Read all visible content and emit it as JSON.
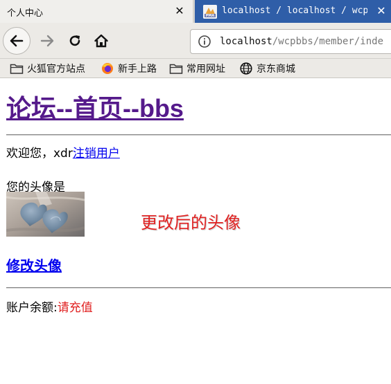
{
  "browser": {
    "tabs": [
      {
        "title": "个人中心",
        "active": true
      },
      {
        "title": "localhost / localhost / wcpbbs",
        "active": false
      }
    ],
    "tab_close_glyph": "✕",
    "url": {
      "host": "localhost",
      "path": "/wcpbbs/member/inde"
    },
    "bookmarks": [
      {
        "label": "火狐官方站点",
        "icon": "folder-icon"
      },
      {
        "label": "新手上路",
        "icon": "firefox-icon"
      },
      {
        "label": "常用网址",
        "icon": "folder-icon"
      },
      {
        "label": "京东商城",
        "icon": "globe-icon"
      }
    ]
  },
  "page": {
    "title": "论坛--首页--bbs",
    "welcome_prefix": "欢迎您，xdr",
    "logout_link": "注销用户",
    "avatar_label": "您的头像是",
    "annotation": "更改后的头像",
    "change_avatar_link": "修改头像",
    "balance_label": "账户余额:",
    "recharge_link": "请充值"
  },
  "colors": {
    "visited_link": "#551a8b",
    "link": "#0000ee",
    "accent_red": "#e02020",
    "active_tab_bg": "#f0efec",
    "inactive_tab_bg": "#2f5ea8"
  }
}
